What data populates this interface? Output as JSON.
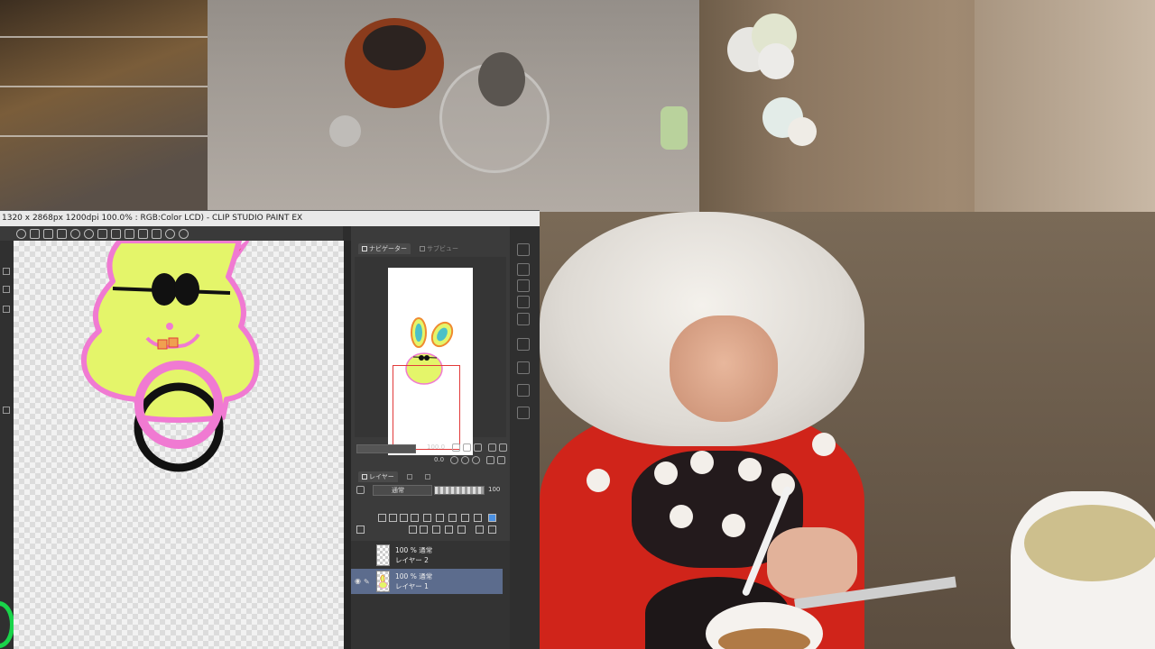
{
  "window": {
    "title": "1320 x 2868px 1200dpi 100.0% : RGB:Color LCD)  - CLIP STUDIO PAINT EX"
  },
  "toolbar": {
    "icons": [
      "tablet-icon",
      "new-file-icon",
      "open-icon",
      "save-icon",
      "undo-icon",
      "redo-icon",
      "clear-icon",
      "fill-icon",
      "transform-icon",
      "select-icon",
      "ruler-icon",
      "help-icon",
      "settings-icon"
    ]
  },
  "navigator": {
    "tab_navigator": "ナビゲーター",
    "tab_subview": "サブビュー",
    "zoom": "100.0",
    "angle": "0.0"
  },
  "layer_panel": {
    "tab_label": "レイヤー",
    "blend_mode": "通常",
    "opacity": "100",
    "layers": [
      {
        "percent_mode": "100 % 通常",
        "name": "レイヤー 2",
        "selected": false
      },
      {
        "percent_mode": "100 % 通常",
        "name": "レイヤー 1",
        "selected": true
      }
    ]
  },
  "colors": {
    "bunny_fill": "#e4f56a",
    "bunny_outline": "#f07ad2",
    "ring_black": "#111111",
    "selection": "#5c6c8d",
    "nav_frame": "#e23a3a"
  }
}
